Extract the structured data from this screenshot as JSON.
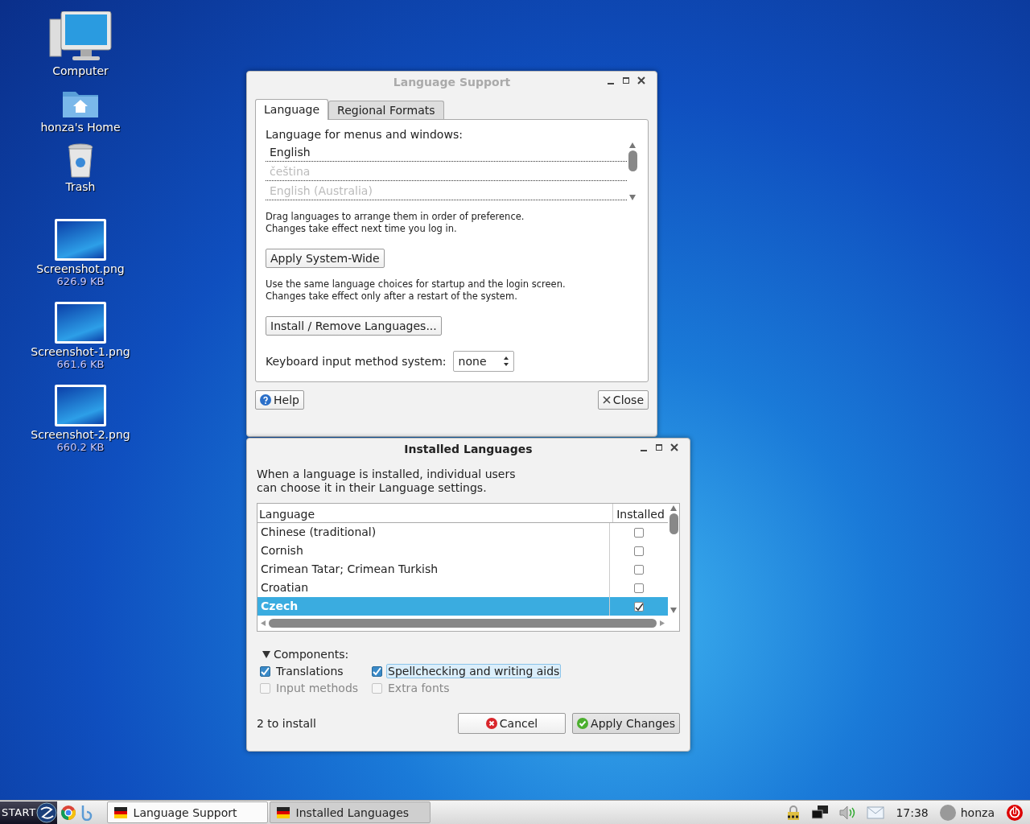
{
  "desktop_icons": [
    {
      "kind": "computer",
      "label": "Computer"
    },
    {
      "kind": "home",
      "label": "honza's Home"
    },
    {
      "kind": "trash",
      "label": "Trash"
    },
    {
      "kind": "image",
      "label": "Screenshot.png",
      "size": "626.9 KB"
    },
    {
      "kind": "image",
      "label": "Screenshot-1.png",
      "size": "661.6 KB"
    },
    {
      "kind": "image",
      "label": "Screenshot-2.png",
      "size": "660.2 KB"
    }
  ],
  "language_support": {
    "title": "Language Support",
    "active": false,
    "tabs": [
      {
        "label": "Language",
        "selected": true
      },
      {
        "label": "Regional Formats",
        "selected": false
      }
    ],
    "list_label": "Language for menus and windows:",
    "languages": [
      {
        "name": "English",
        "dimmed": false
      },
      {
        "name": "čeština",
        "dimmed": true
      },
      {
        "name": "English (Australia)",
        "dimmed": true
      }
    ],
    "drag_hint": "Drag languages to arrange them in order of preference.\nChanges take effect next time you log in.",
    "apply_button": "Apply System-Wide",
    "apply_hint": "Use the same language choices for startup and the login screen.\nChanges take effect only after a restart of the system.",
    "install_button": "Install / Remove Languages...",
    "keyboard_label": "Keyboard input method system:",
    "keyboard_value": "none",
    "help_button": "Help",
    "close_button": "Close"
  },
  "installed_languages": {
    "title": "Installed Languages",
    "active": true,
    "description": "When a language is installed, individual users\ncan choose it in their Language settings.",
    "columns": [
      "Language",
      "Installed"
    ],
    "rows": [
      {
        "language": "Chinese (traditional)",
        "installed": false,
        "selected": false
      },
      {
        "language": "Cornish",
        "installed": false,
        "selected": false
      },
      {
        "language": "Crimean Tatar; Crimean Turkish",
        "installed": false,
        "selected": false
      },
      {
        "language": "Croatian",
        "installed": false,
        "selected": false
      },
      {
        "language": "Czech",
        "installed": true,
        "selected": true
      }
    ],
    "components_label": "Components:",
    "components_expanded": true,
    "components": [
      {
        "label": "Translations",
        "checked": true,
        "disabled": false,
        "focused": false
      },
      {
        "label": "Spellchecking and writing aids",
        "checked": true,
        "disabled": false,
        "focused": true
      },
      {
        "label": "Input methods",
        "checked": false,
        "disabled": true,
        "focused": false
      },
      {
        "label": "Extra fonts",
        "checked": false,
        "disabled": true,
        "focused": false
      }
    ],
    "status": "2 to install",
    "cancel_button": "Cancel",
    "apply_button": "Apply Changes"
  },
  "taskbar": {
    "start_label": "START",
    "tasks": [
      {
        "label": "Language Support",
        "selected": true
      },
      {
        "label": "Installed Languages",
        "selected": false
      }
    ],
    "clock": "17:38",
    "user": "honza"
  }
}
